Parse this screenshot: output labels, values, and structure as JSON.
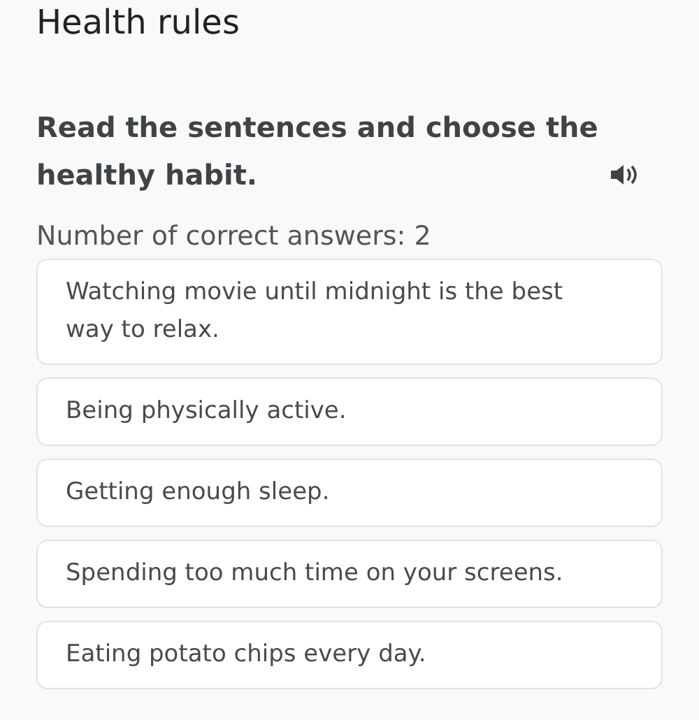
{
  "title": "Health rules",
  "question": "Read the sentences and choose the healthy habit.",
  "answer_count": "Number of correct answers: 2",
  "options": [
    {
      "label": "Watching movie until midnight is the best way to relax."
    },
    {
      "label": "Being physically active."
    },
    {
      "label": "Getting enough sleep."
    },
    {
      "label": "Spending too much time on your screens."
    },
    {
      "label": "Eating potato chips every day."
    }
  ]
}
